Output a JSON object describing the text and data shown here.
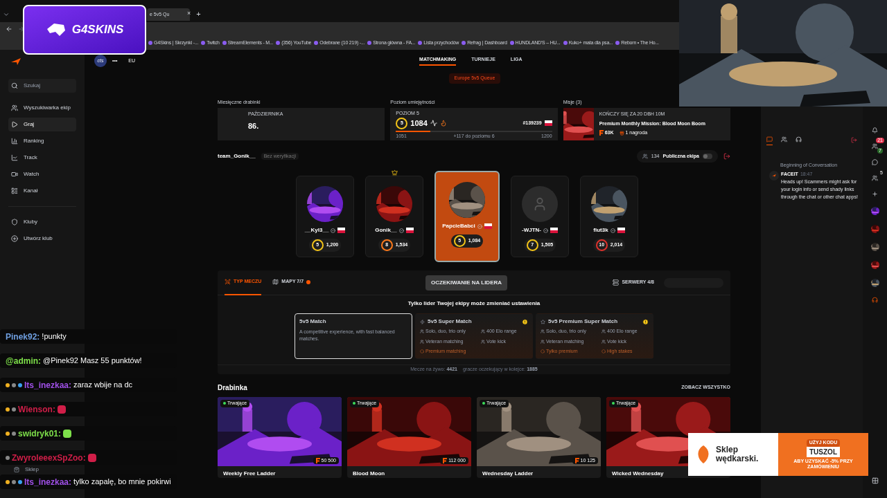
{
  "browser": {
    "tab_title": "e 5v5 Qu",
    "tab_close": "×",
    "new_tab": "+",
    "bookmarks": [
      "G4Skins | Skrzynki -...",
      "Twitch",
      "StreamElements - M...",
      "(356) YouTube",
      "Odebrane (10 219) -...",
      "Strona główna - FA...",
      "Lista przychodów",
      "Refrag | Dashboard",
      "HUNDLAND'S – HU...",
      "Kuko+ mata dla psa...",
      "Reborn • The Ho..."
    ]
  },
  "logo_overlay": {
    "text": "G4SKINS"
  },
  "sidebar": {
    "search": {
      "placeholder": "Szukaj"
    },
    "items": [
      {
        "label": "Wyszukiwarka ekip",
        "selected": false
      },
      {
        "label": "Graj",
        "selected": true
      },
      {
        "label": "Ranking",
        "selected": false
      },
      {
        "label": "Track",
        "selected": false
      },
      {
        "label": "Watch",
        "selected": false
      },
      {
        "label": "Kanał",
        "selected": false
      }
    ],
    "clubs": [
      {
        "label": "Kluby"
      },
      {
        "label": "Utwórz klub"
      }
    ],
    "shop": "Sklep"
  },
  "header": {
    "avatar": "cts",
    "more": "•••",
    "region": "EU",
    "nav": [
      {
        "label": "MATCHMAKING",
        "selected": true
      },
      {
        "label": "TURNIEJE",
        "selected": false
      },
      {
        "label": "LIGA",
        "selected": false
      }
    ],
    "queue": "Europe 5v5 Queue"
  },
  "stats": {
    "ladder": {
      "label": "Miesięczne drabinki",
      "month": "PAŹDZIERNIKA",
      "place": "86."
    },
    "skill": {
      "label": "Poziom umiejętności",
      "level_name": "POZIOM 5",
      "badge": "5",
      "elo": "1084",
      "rank": "#139239",
      "level": 0.22,
      "min": "1051",
      "to_next": "+117 do poziomu 6",
      "max": "1200"
    },
    "missions": {
      "label": "Misje (3)",
      "ends": "KOŃCZY SIĘ ZA 20 DBH 10M",
      "title": "Premium Monthly Mission: Blood Moon Boom",
      "points": "63K",
      "rewards": "1 nagroda"
    }
  },
  "team": {
    "name": "team_Gonik__",
    "verification": "Bez weryfikacji",
    "count": "134",
    "public_label": "Publiczna ekipa",
    "public_on": false
  },
  "players": [
    {
      "name": "__Kyl3__",
      "badge": "5",
      "elo": "1,200",
      "color": "#f5c518",
      "leader": false,
      "highlighted": false,
      "kind": "picture"
    },
    {
      "name": "Gonik__",
      "badge": "8",
      "elo": "1,534",
      "color": "#ff7a1a",
      "leader": true,
      "highlighted": false,
      "kind": "picture"
    },
    {
      "name": "PapcieBabci",
      "badge": "5",
      "elo": "1,084",
      "color": "#f5c518",
      "leader": false,
      "highlighted": true,
      "kind": "picture"
    },
    {
      "name": "-WJTN-",
      "badge": "7",
      "elo": "1,505",
      "color": "#f5c518",
      "leader": false,
      "highlighted": false,
      "kind": "default"
    },
    {
      "name": "fiut3k",
      "badge": "10",
      "elo": "2,014",
      "color": "#e0312b",
      "leader": false,
      "highlighted": false,
      "kind": "picture"
    }
  ],
  "settings": {
    "tabs": [
      {
        "label": "TYP MECZU",
        "selected": true,
        "dot": false
      },
      {
        "label": "MAPY 7/7",
        "selected": false,
        "dot": true
      }
    ],
    "wait_button": "OCZEKIWANIE NA LIDERA",
    "servers": "SERWERY 4/8",
    "notice": "Tylko lider Twojej ekipy może zmieniać ustawienia",
    "match_types": [
      {
        "title": "5v5 Match",
        "description": "A competitive experience, with fast balanced matches.",
        "selected": true,
        "warning": false
      },
      {
        "title": "5v5 Super Match",
        "selected": false,
        "warning": true,
        "features": [
          {
            "label": "Solo, duo, trio only",
            "kind": "normal"
          },
          {
            "label": "400 Elo range",
            "kind": "normal"
          },
          {
            "label": "Veteran matching",
            "kind": "normal"
          },
          {
            "label": "Vote kick",
            "kind": "normal"
          },
          {
            "label": "Premium matching",
            "kind": "premium"
          }
        ]
      },
      {
        "title": "5v5 Premium Super Match",
        "selected": false,
        "warning": true,
        "features": [
          {
            "label": "Solo, duo, trio only",
            "kind": "normal"
          },
          {
            "label": "400 Elo range",
            "kind": "normal"
          },
          {
            "label": "Veteran matching",
            "kind": "normal"
          },
          {
            "label": "Vote kick",
            "kind": "normal"
          },
          {
            "label": "Tylko premium",
            "kind": "premium"
          },
          {
            "label": "High stakes",
            "kind": "premium"
          }
        ]
      }
    ],
    "live_label": "Mecze na żywo:",
    "live": "4421",
    "waiting_label": "gracze oczekujący w kolejce:",
    "waiting": "1885"
  },
  "ladders": {
    "title": "Drabinka",
    "see_all": "ZOBACZ WSZYSTKO",
    "cards": [
      {
        "status": "Trwające",
        "prize": "50 500",
        "title": "Weekly Free Ladder",
        "color": "#6b21c8"
      },
      {
        "status": "Trwające",
        "prize": "112 000",
        "title": "Blood Moon",
        "color": "#8a1414"
      },
      {
        "status": "Trwające",
        "prize": "10 125",
        "title": "Wednesday Ladder",
        "color": "#3a3530"
      },
      {
        "status": "Trwające",
        "title": "Wicked Wednesday",
        "color": "#9a1a1a"
      }
    ]
  },
  "chat_panel": {
    "tabs": [
      {
        "selected": true
      },
      {
        "selected": false
      },
      {
        "selected": false
      }
    ],
    "start": "Beginning of Conversation",
    "sender": "FACEIT",
    "time": "18:47",
    "message": "Heads up! Scammers might ask for your login info or send shady links through the chat or other chat apps!"
  },
  "rail": {
    "friends_badge": "21",
    "online_badge": "7",
    "party_badge": "5"
  },
  "stream_chat": [
    {
      "user": "Pinek92:",
      "color": "#6f9fe0",
      "kind": "text",
      "text": "!punkty"
    },
    {
      "user": "@admin:",
      "color": "#7ee04a",
      "kind": "text",
      "text": "@Pinek92 Masz 55 punktów!"
    },
    {
      "user": "Its_inezkaa:",
      "color": "#a050e8",
      "kind": "text",
      "text": "zaraz wbije na dc",
      "badges": [
        {
          "kind": "sub"
        },
        {
          "kind": "sword"
        },
        {
          "kind": "gem"
        }
      ]
    },
    {
      "user": "Wienson:",
      "color": "#d01e48",
      "kind": "emote",
      "badges": [
        {
          "kind": "sub"
        },
        {
          "kind": "sword"
        }
      ]
    },
    {
      "user": "swidryk01:",
      "color": "#7ee04a",
      "kind": "emote",
      "badges": [
        {
          "kind": "sub"
        },
        {
          "kind": "sword"
        }
      ]
    },
    {
      "user": "ZwyroleeexSpZoo:",
      "color": "#d01e48",
      "kind": "emote",
      "badges": [
        {
          "kind": "sword"
        }
      ]
    },
    {
      "user": "Its_inezkaa:",
      "color": "#a050e8",
      "kind": "text",
      "text": "tylko zapalę, bo mnie pokirwi",
      "badges": [
        {
          "kind": "sub"
        },
        {
          "kind": "sword"
        },
        {
          "kind": "gem"
        }
      ]
    }
  ],
  "ad": {
    "brand_top": "Sklep",
    "brand_bottom": "wędkarski.",
    "code_label": "UŻYJ KODU",
    "code": "TUSZOL",
    "note": "ABY UZYSKAĆ -5% PRZY ZAMÓWIENIU"
  }
}
